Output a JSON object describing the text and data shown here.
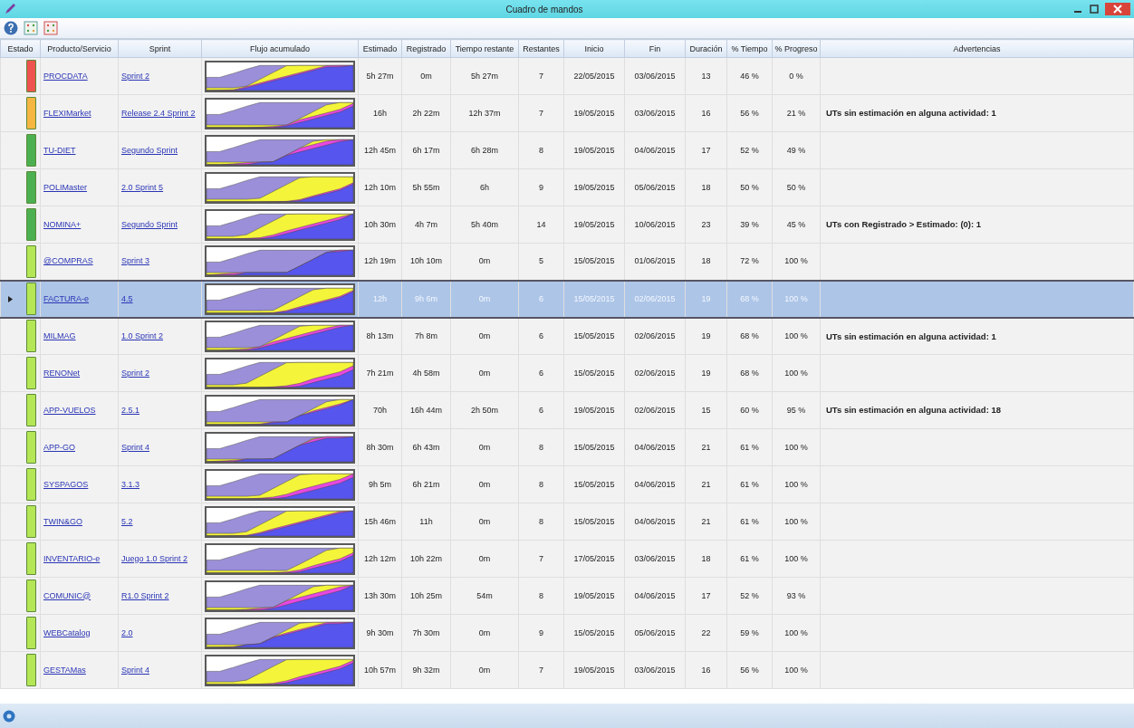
{
  "window": {
    "title": "Cuadro de mandos"
  },
  "table": {
    "columns": [
      "Estado",
      "Producto/Servicio",
      "Sprint",
      "Flujo acumulado",
      "Estimado",
      "Registrado",
      "Tiempo restante",
      "Restantes",
      "Inicio",
      "Fin",
      "Duración",
      "% Tiempo",
      "% Progreso",
      "Advertencias"
    ],
    "rows": [
      {
        "color": "#ef5350",
        "product": "PROCDATA",
        "sprint": "Sprint 2",
        "estimado": "5h 27m",
        "registrado": "0m",
        "tiempo_restante": "5h 27m",
        "restantes": "7",
        "inicio": "22/05/2015",
        "fin": "03/06/2015",
        "duracion": "13",
        "pct_tiempo": "46 %",
        "pct_progreso": "0 %",
        "selected": false
      },
      {
        "color": "#f5b642",
        "product": "FLEXIMarket",
        "sprint": "Release 2.4 Sprint 2",
        "estimado": "16h",
        "registrado": "2h 22m",
        "tiempo_restante": "12h 37m",
        "restantes": "7",
        "inicio": "19/05/2015",
        "fin": "03/06/2015",
        "duracion": "16",
        "pct_tiempo": "56 %",
        "pct_progreso": "21 %",
        "warning": "UTs sin estimación en alguna actividad: 1",
        "selected": false
      },
      {
        "color": "#4caf50",
        "product": "TU-DIET",
        "sprint": "Segundo Sprint",
        "estimado": "12h 45m",
        "registrado": "6h 17m",
        "tiempo_restante": "6h 28m",
        "restantes": "8",
        "inicio": "19/05/2015",
        "fin": "04/06/2015",
        "duracion": "17",
        "pct_tiempo": "52 %",
        "pct_progreso": "49 %",
        "selected": false
      },
      {
        "color": "#4caf50",
        "product": "POLIMaster",
        "sprint": "2.0 Sprint 5",
        "estimado": "12h 10m",
        "registrado": "5h 55m",
        "tiempo_restante": "6h",
        "restantes": "9",
        "inicio": "19/05/2015",
        "fin": "05/06/2015",
        "duracion": "18",
        "pct_tiempo": "50 %",
        "pct_progreso": "50 %",
        "selected": false
      },
      {
        "color": "#4caf50",
        "product": "NOMINA+",
        "sprint": "Segundo Sprint",
        "estimado": "10h 30m",
        "registrado": "4h 7m",
        "tiempo_restante": "5h 40m",
        "restantes": "14",
        "inicio": "19/05/2015",
        "fin": "10/06/2015",
        "duracion": "23",
        "pct_tiempo": "39 %",
        "pct_progreso": "45 %",
        "warning": "UTs con Registrado > Estimado: (0): 1",
        "selected": false
      },
      {
        "color": "#b5e655",
        "product": "@COMPRAS",
        "sprint": "Sprint 3",
        "estimado": "12h 19m",
        "registrado": "10h 10m",
        "tiempo_restante": "0m",
        "restantes": "5",
        "inicio": "15/05/2015",
        "fin": "01/06/2015",
        "duracion": "18",
        "pct_tiempo": "72 %",
        "pct_progreso": "100 %",
        "selected": false
      },
      {
        "color": "#b5e655",
        "product": "FACTURA-e",
        "sprint": "4.5",
        "estimado": "12h",
        "registrado": "9h 6m",
        "tiempo_restante": "0m",
        "restantes": "6",
        "inicio": "15/05/2015",
        "fin": "02/06/2015",
        "duracion": "19",
        "pct_tiempo": "68 %",
        "pct_progreso": "100 %",
        "selected": true
      },
      {
        "color": "#b5e655",
        "product": "MILMAG",
        "sprint": "1.0 Sprint 2",
        "estimado": "8h 13m",
        "registrado": "7h 8m",
        "tiempo_restante": "0m",
        "restantes": "6",
        "inicio": "15/05/2015",
        "fin": "02/06/2015",
        "duracion": "19",
        "pct_tiempo": "68 %",
        "pct_progreso": "100 %",
        "warning": "UTs sin estimación en alguna actividad: 1",
        "selected": false
      },
      {
        "color": "#b5e655",
        "product": "RENONet",
        "sprint": "Sprint 2",
        "estimado": "7h 21m",
        "registrado": "4h 58m",
        "tiempo_restante": "0m",
        "restantes": "6",
        "inicio": "15/05/2015",
        "fin": "02/06/2015",
        "duracion": "19",
        "pct_tiempo": "68 %",
        "pct_progreso": "100 %",
        "selected": false
      },
      {
        "color": "#b5e655",
        "product": "APP-VUELOS",
        "sprint": "2.5.1",
        "estimado": "70h",
        "registrado": "16h 44m",
        "tiempo_restante": "2h 50m",
        "restantes": "6",
        "inicio": "19/05/2015",
        "fin": "02/06/2015",
        "duracion": "15",
        "pct_tiempo": "60 %",
        "pct_progreso": "95 %",
        "warning": "UTs sin estimación en alguna actividad: 18",
        "selected": false
      },
      {
        "color": "#b5e655",
        "product": "APP-GO",
        "sprint": "Sprint 4",
        "estimado": "8h 30m",
        "registrado": "6h 43m",
        "tiempo_restante": "0m",
        "restantes": "8",
        "inicio": "15/05/2015",
        "fin": "04/06/2015",
        "duracion": "21",
        "pct_tiempo": "61 %",
        "pct_progreso": "100 %",
        "selected": false
      },
      {
        "color": "#b5e655",
        "product": "SYSPAGOS",
        "sprint": "3.1.3",
        "estimado": "9h 5m",
        "registrado": "6h 21m",
        "tiempo_restante": "0m",
        "restantes": "8",
        "inicio": "15/05/2015",
        "fin": "04/06/2015",
        "duracion": "21",
        "pct_tiempo": "61 %",
        "pct_progreso": "100 %",
        "selected": false
      },
      {
        "color": "#b5e655",
        "product": "TWIN&GO",
        "sprint": "5.2",
        "estimado": "15h 46m",
        "registrado": "11h",
        "tiempo_restante": "0m",
        "restantes": "8",
        "inicio": "15/05/2015",
        "fin": "04/06/2015",
        "duracion": "21",
        "pct_tiempo": "61 %",
        "pct_progreso": "100 %",
        "selected": false
      },
      {
        "color": "#b5e655",
        "product": "INVENTARIO-e",
        "sprint": "Juego 1.0 Sprint 2",
        "estimado": "12h 12m",
        "registrado": "10h 22m",
        "tiempo_restante": "0m",
        "restantes": "7",
        "inicio": "17/05/2015",
        "fin": "03/06/2015",
        "duracion": "18",
        "pct_tiempo": "61 %",
        "pct_progreso": "100 %",
        "selected": false
      },
      {
        "color": "#b5e655",
        "product": "COMUNIC@",
        "sprint": "R1.0 Sprint 2",
        "estimado": "13h 30m",
        "registrado": "10h 25m",
        "tiempo_restante": "54m",
        "restantes": "8",
        "inicio": "19/05/2015",
        "fin": "04/06/2015",
        "duracion": "17",
        "pct_tiempo": "52 %",
        "pct_progreso": "93 %",
        "selected": false
      },
      {
        "color": "#b5e655",
        "product": "WEBCatalog",
        "sprint": "2.0",
        "estimado": "9h 30m",
        "registrado": "7h 30m",
        "tiempo_restante": "0m",
        "restantes": "9",
        "inicio": "15/05/2015",
        "fin": "05/06/2015",
        "duracion": "22",
        "pct_tiempo": "59 %",
        "pct_progreso": "100 %",
        "selected": false
      },
      {
        "color": "#b5e655",
        "product": "GESTAMas",
        "sprint": "Sprint 4",
        "estimado": "10h 57m",
        "registrado": "9h 32m",
        "tiempo_restante": "0m",
        "restantes": "7",
        "inicio": "19/05/2015",
        "fin": "03/06/2015",
        "duracion": "16",
        "pct_tiempo": "56 %",
        "pct_progreso": "100 %",
        "selected": false
      }
    ]
  }
}
